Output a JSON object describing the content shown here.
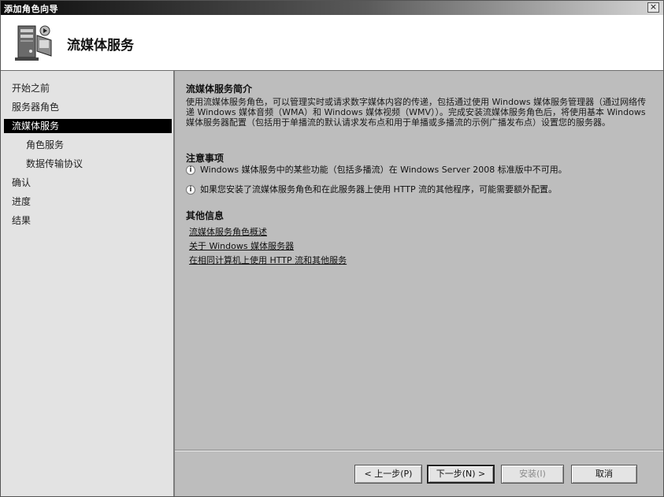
{
  "window": {
    "title": "添加角色向导",
    "close_label": "×"
  },
  "header": {
    "title": "流媒体服务",
    "icon": "server-computer-icon"
  },
  "sidebar": {
    "items": [
      {
        "label": "开始之前",
        "active": false,
        "level": 0
      },
      {
        "label": "服务器角色",
        "active": false,
        "level": 0
      },
      {
        "label": "流媒体服务",
        "active": true,
        "level": 0
      },
      {
        "label": "角色服务",
        "active": false,
        "level": 1
      },
      {
        "label": "数据传输协议",
        "active": false,
        "level": 1
      },
      {
        "label": "确认",
        "active": false,
        "level": 0
      },
      {
        "label": "进度",
        "active": false,
        "level": 0
      },
      {
        "label": "结果",
        "active": false,
        "level": 0
      }
    ]
  },
  "main": {
    "intro": {
      "title": "流媒体服务简介",
      "text": "使用流媒体服务角色，可以管理实时或请求数字媒体内容的传递，包括通过使用 Windows 媒体服务管理器（通过网络传递 Windows 媒体音频（WMA）和 Windows 媒体视频（WMV））。完成安装流媒体服务角色后，将使用基本 Windows 媒体服务器配置（包括用于单播流的默认请求发布点和用于单播或多播流的示例广播发布点）设置您的服务器。"
    },
    "notes": {
      "title": "注意事项",
      "items": [
        "Windows 媒体服务中的某些功能（包括多播流）在 Windows Server 2008 标准版中不可用。",
        "如果您安装了流媒体服务角色和在此服务器上使用 HTTP 流的其他程序，可能需要额外配置。"
      ]
    },
    "more_info": {
      "title": "其他信息",
      "links": [
        "流媒体服务角色概述",
        "关于 Windows 媒体服务器",
        "在相同计算机上使用 HTTP 流和其他服务"
      ]
    }
  },
  "buttons": {
    "back": "< 上一步(P)",
    "next": "下一步(N) >",
    "install": "安装(I)",
    "cancel": "取消"
  },
  "colors": {
    "active_nav_bg": "#000000",
    "content_bg": "#bdbdbd",
    "nav_bg": "#e3e3e3"
  }
}
